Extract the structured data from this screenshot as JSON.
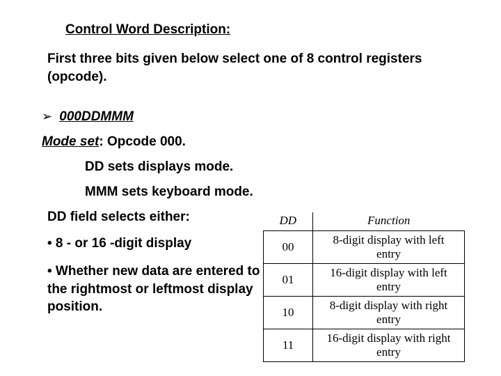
{
  "heading": "Control Word Description:",
  "intro": "First three bits given below select one of 8 control registers (opcode).",
  "bullet_term": "000DDMMM",
  "mode_set_label": "Mode set",
  "mode_set_rest": ": Opcode 000.",
  "sub1": "DD sets displays mode.",
  "sub2": "MMM sets keyboard mode.",
  "dd_heading": "DD field selects either:",
  "dot1": "• 8 - or 16 -digit display",
  "dot2": "• Whether new data are entered to the rightmost or leftmost display position.",
  "table": {
    "head_dd": "DD",
    "head_fn": "Function",
    "rows": [
      {
        "dd": "00",
        "fn": "8-digit display with left entry"
      },
      {
        "dd": "01",
        "fn": "16-digit display with left entry"
      },
      {
        "dd": "10",
        "fn": "8-digit display with right entry"
      },
      {
        "dd": "11",
        "fn": "16-digit display with right entry"
      }
    ]
  }
}
